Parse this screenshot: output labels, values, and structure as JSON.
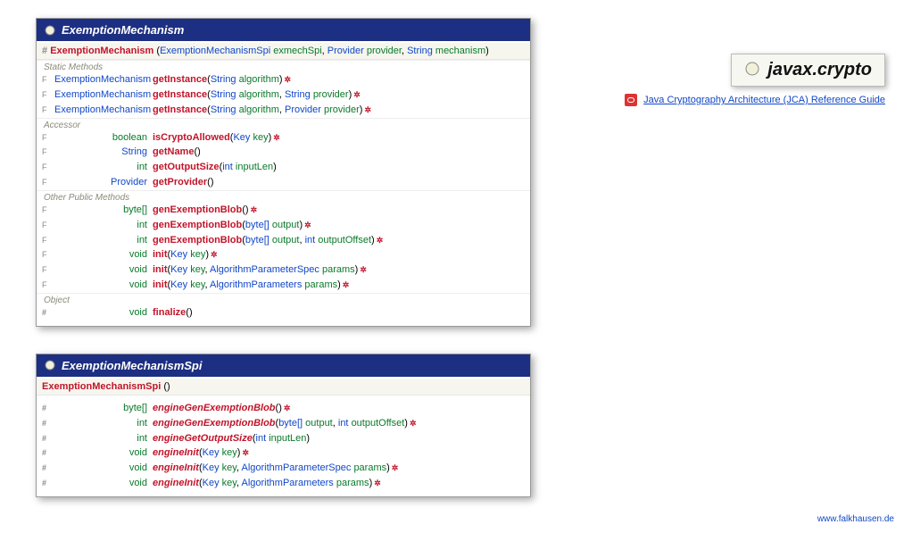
{
  "package": {
    "name": "javax.crypto",
    "guide_label": "Java Cryptography Architecture (JCA) Reference Guide"
  },
  "watermark": "www.falkhausen.de",
  "class1": {
    "name": "ExemptionMechanism",
    "ctor": {
      "name": "ExemptionMechanism",
      "params": [
        {
          "type": "ExemptionMechanismSpi",
          "name": "exmechSpi"
        },
        {
          "type": "Provider",
          "name": "provider"
        },
        {
          "type": "String",
          "name": "mechanism"
        }
      ]
    },
    "sections": {
      "static_label": "Static Methods",
      "accessor_label": "Accessor",
      "other_label": "Other Public Methods",
      "object_label": "Object"
    },
    "static": [
      {
        "flag": "F",
        "ret": "ExemptionMechanism",
        "name": "getInstance",
        "params": [
          {
            "type": "String",
            "name": "algorithm"
          }
        ],
        "exc": true
      },
      {
        "flag": "F",
        "ret": "ExemptionMechanism",
        "name": "getInstance",
        "params": [
          {
            "type": "String",
            "name": "algorithm"
          },
          {
            "type": "String",
            "name": "provider"
          }
        ],
        "exc": true
      },
      {
        "flag": "F",
        "ret": "ExemptionMechanism",
        "name": "getInstance",
        "params": [
          {
            "type": "String",
            "name": "algorithm"
          },
          {
            "type": "Provider",
            "name": "provider"
          }
        ],
        "exc": true
      }
    ],
    "accessor": [
      {
        "flag": "F",
        "ret": "boolean",
        "retClass": "green",
        "name": "isCryptoAllowed",
        "params": [
          {
            "type": "Key",
            "name": "key"
          }
        ],
        "exc": true
      },
      {
        "flag": "F",
        "ret": "String",
        "retClass": "blue",
        "name": "getName",
        "params": []
      },
      {
        "flag": "F",
        "ret": "int",
        "retClass": "green",
        "name": "getOutputSize",
        "params": [
          {
            "type": "int",
            "name": "inputLen"
          }
        ]
      },
      {
        "flag": "F",
        "ret": "Provider",
        "retClass": "blue",
        "name": "getProvider",
        "params": []
      }
    ],
    "other": [
      {
        "flag": "F",
        "ret": "byte[]",
        "retClass": "green",
        "name": "genExemptionBlob",
        "params": [],
        "exc": true
      },
      {
        "flag": "F",
        "ret": "int",
        "retClass": "green",
        "name": "genExemptionBlob",
        "params": [
          {
            "type": "byte[]",
            "name": "output"
          }
        ],
        "exc": true
      },
      {
        "flag": "F",
        "ret": "int",
        "retClass": "green",
        "name": "genExemptionBlob",
        "params": [
          {
            "type": "byte[]",
            "name": "output"
          },
          {
            "type": "int",
            "name": "outputOffset"
          }
        ],
        "exc": true
      },
      {
        "flag": "F",
        "ret": "void",
        "retClass": "green",
        "name": "init",
        "params": [
          {
            "type": "Key",
            "name": "key"
          }
        ],
        "exc": true
      },
      {
        "flag": "F",
        "ret": "void",
        "retClass": "green",
        "name": "init",
        "params": [
          {
            "type": "Key",
            "name": "key"
          },
          {
            "type": "AlgorithmParameterSpec",
            "name": "params"
          }
        ],
        "exc": true
      },
      {
        "flag": "F",
        "ret": "void",
        "retClass": "green",
        "name": "init",
        "params": [
          {
            "type": "Key",
            "name": "key"
          },
          {
            "type": "AlgorithmParameters",
            "name": "params"
          }
        ],
        "exc": true
      }
    ],
    "object": [
      {
        "flag": "#",
        "ret": "void",
        "retClass": "green",
        "name": "finalize",
        "params": []
      }
    ]
  },
  "class2": {
    "name": "ExemptionMechanismSpi",
    "ctor": {
      "name": "ExemptionMechanismSpi",
      "params": []
    },
    "methods": [
      {
        "flag": "#",
        "ret": "byte[]",
        "retClass": "green",
        "name": "engineGenExemptionBlob",
        "italic": true,
        "params": [],
        "exc": true
      },
      {
        "flag": "#",
        "ret": "int",
        "retClass": "green",
        "name": "engineGenExemptionBlob",
        "italic": true,
        "params": [
          {
            "type": "byte[]",
            "name": "output"
          },
          {
            "type": "int",
            "name": "outputOffset"
          }
        ],
        "exc": true
      },
      {
        "flag": "#",
        "ret": "int",
        "retClass": "green",
        "name": "engineGetOutputSize",
        "italic": true,
        "params": [
          {
            "type": "int",
            "name": "inputLen"
          }
        ]
      },
      {
        "flag": "#",
        "ret": "void",
        "retClass": "green",
        "name": "engineInit",
        "italic": true,
        "params": [
          {
            "type": "Key",
            "name": "key"
          }
        ],
        "exc": true
      },
      {
        "flag": "#",
        "ret": "void",
        "retClass": "green",
        "name": "engineInit",
        "italic": true,
        "params": [
          {
            "type": "Key",
            "name": "key"
          },
          {
            "type": "AlgorithmParameterSpec",
            "name": "params"
          }
        ],
        "exc": true
      },
      {
        "flag": "#",
        "ret": "void",
        "retClass": "green",
        "name": "engineInit",
        "italic": true,
        "params": [
          {
            "type": "Key",
            "name": "key"
          },
          {
            "type": "AlgorithmParameters",
            "name": "params"
          }
        ],
        "exc": true
      }
    ]
  }
}
